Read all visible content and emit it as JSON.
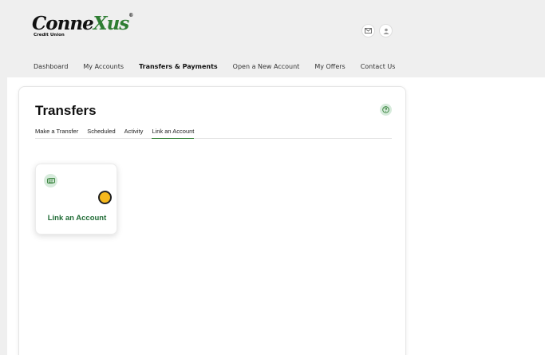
{
  "header": {
    "logo_text_a": "Conne",
    "logo_text_b": "Xus",
    "logo_registered": "®",
    "logo_subtitle": "Credit Union",
    "icons": [
      "mail-icon",
      "user-icon"
    ]
  },
  "nav": {
    "items": [
      {
        "label": "Dashboard",
        "active": false
      },
      {
        "label": "My Accounts",
        "active": false
      },
      {
        "label": "Transfers & Payments",
        "active": true
      },
      {
        "label": "Open a New Account",
        "active": false
      },
      {
        "label": "My Offers",
        "active": false
      },
      {
        "label": "Contact Us",
        "active": false
      }
    ]
  },
  "page": {
    "title": "Transfers",
    "help_icon": "help-icon"
  },
  "tabs": [
    {
      "label": "Make a Transfer",
      "active": false
    },
    {
      "label": "Scheduled",
      "active": false
    },
    {
      "label": "Activity",
      "active": false
    },
    {
      "label": "Link an Account",
      "active": true
    }
  ],
  "tile": {
    "icon": "link-account-icon",
    "label": "Link an Account"
  },
  "colors": {
    "brand_green": "#2e7d32",
    "icon_bg": "#d7ebdc",
    "cursor": "#f5b81c"
  }
}
